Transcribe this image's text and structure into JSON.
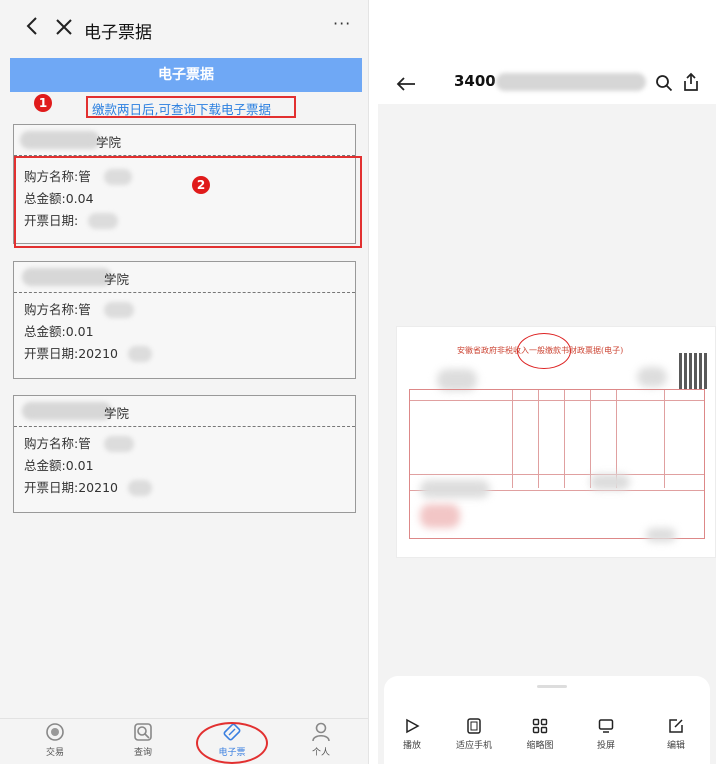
{
  "left_panel": {
    "window_title": "电子票据",
    "more_label": "···",
    "header_title": "电子票据",
    "markers": [
      "1",
      "2"
    ],
    "notice": "缴款两日后,可查询下载电子票据",
    "cards": [
      {
        "school_suffix": "学院",
        "buyer": "购方名称:管",
        "total": "总金额:0.04",
        "date": "开票日期:"
      },
      {
        "school_suffix": "学院",
        "buyer": "购方名称:管",
        "total": "总金额:0.01",
        "date": "开票日期:20210"
      },
      {
        "school_suffix": "学院",
        "buyer": "购方名称:管",
        "total": "总金额:0.01",
        "date": "开票日期:20210"
      }
    ],
    "nav": [
      {
        "label": "交易",
        "icon": "transaction-icon"
      },
      {
        "label": "查询",
        "icon": "search-icon"
      },
      {
        "label": "电子票",
        "icon": "ticket-icon",
        "active": true
      },
      {
        "label": "个人",
        "icon": "person-icon"
      }
    ],
    "accent_color": "#6fa8f5",
    "highlight_color": "#e23030"
  },
  "right_panel": {
    "file_name": "3400",
    "document_title": "安徽省政府非税收入一般缴款书财政票据(电子)",
    "toolbar": [
      {
        "label": "播放",
        "icon": "play-icon"
      },
      {
        "label": "适应手机",
        "icon": "fit-screen-icon"
      },
      {
        "label": "缩略图",
        "icon": "thumbnail-icon"
      },
      {
        "label": "投屏",
        "icon": "cast-icon"
      },
      {
        "label": "编辑",
        "icon": "edit-icon"
      }
    ]
  }
}
